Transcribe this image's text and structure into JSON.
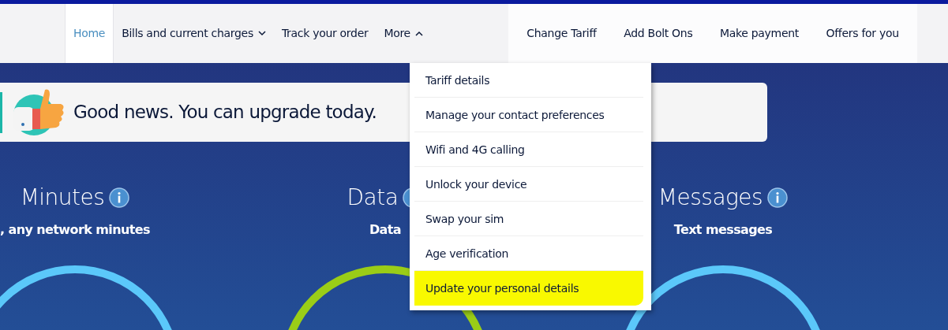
{
  "nav": {
    "left_items": [
      {
        "label": "Home",
        "kind": "link",
        "selected": true
      },
      {
        "label": "Bills and current charges",
        "kind": "dropdown",
        "selected": false,
        "expanded": false
      },
      {
        "label": "Track your order",
        "kind": "link",
        "selected": false
      },
      {
        "label": "More",
        "kind": "dropdown",
        "selected": false,
        "expanded": true
      }
    ],
    "right_items": [
      {
        "label": "Change Tariff"
      },
      {
        "label": "Add Bolt Ons"
      },
      {
        "label": "Make payment"
      },
      {
        "label": "Offers for you"
      }
    ]
  },
  "more_menu": [
    {
      "label": "Tariff details",
      "highlighted": false
    },
    {
      "label": "Manage your contact preferences",
      "highlighted": false
    },
    {
      "label": "Wifi and 4G calling",
      "highlighted": false
    },
    {
      "label": "Unlock your device",
      "highlighted": false
    },
    {
      "label": "Swap your sim",
      "highlighted": false
    },
    {
      "label": "Age verification",
      "highlighted": false
    },
    {
      "label": "Update your personal details",
      "highlighted": true
    }
  ],
  "banner": {
    "text": "Good news. You can upgrade today."
  },
  "allowances": [
    {
      "title": "Minutes",
      "subtitle": ", any network minutes",
      "color": "#5bc8fa"
    },
    {
      "title": "Data",
      "subtitle": "Data",
      "color": "#9acd17"
    },
    {
      "title": "Messages",
      "subtitle": "Text messages",
      "color": "#5bc8fa"
    }
  ]
}
